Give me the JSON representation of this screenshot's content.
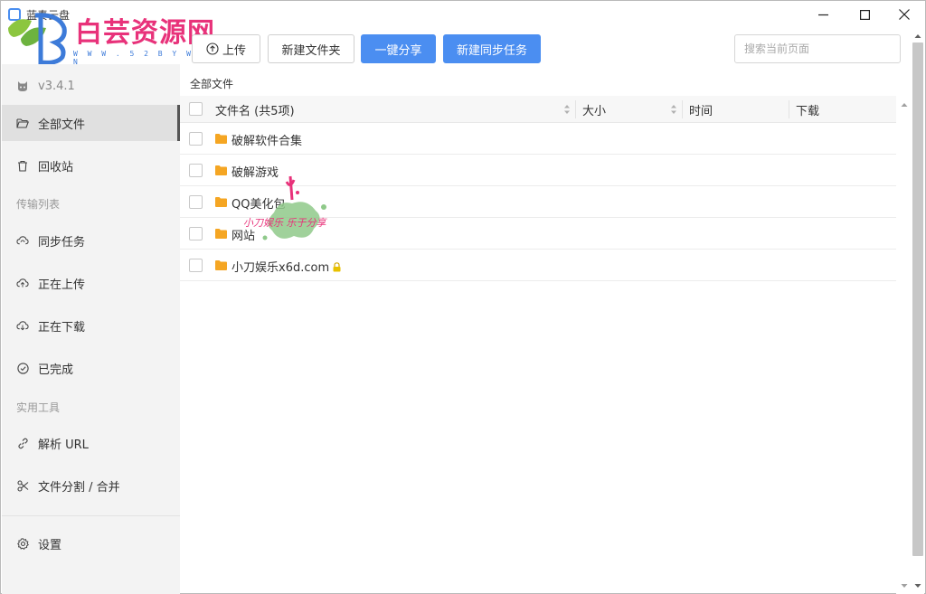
{
  "window": {
    "title": "蓝奏云盘",
    "controls": {
      "minimize": "minimize-icon",
      "maximize": "maximize-icon",
      "close": "close-icon"
    }
  },
  "watermark": {
    "logo_text": "白芸资源网",
    "logo_url": "W W W . 5 2 B Y W . C N",
    "stamp_text": "小刀娱乐 乐于分享"
  },
  "sidebar": {
    "version": "v3.4.1",
    "items": [
      {
        "label": "全部文件",
        "icon": "folder-open-icon",
        "active": true
      },
      {
        "label": "回收站",
        "icon": "trash-icon",
        "active": false
      }
    ],
    "transfer_section": "传输列表",
    "transfer_items": [
      {
        "label": "同步任务",
        "icon": "cloud-sync-icon"
      },
      {
        "label": "正在上传",
        "icon": "cloud-upload-icon"
      },
      {
        "label": "正在下载",
        "icon": "cloud-download-icon"
      },
      {
        "label": "已完成",
        "icon": "check-circle-icon"
      }
    ],
    "tools_section": "实用工具",
    "tool_items": [
      {
        "label": "解析 URL",
        "icon": "link-icon"
      },
      {
        "label": "文件分割 / 合并",
        "icon": "scissors-icon"
      }
    ],
    "settings": {
      "label": "设置",
      "icon": "gear-icon"
    }
  },
  "toolbar": {
    "upload": "上传",
    "new_folder": "新建文件夹",
    "share": "一键分享",
    "new_sync": "新建同步任务",
    "search_placeholder": "搜索当前页面"
  },
  "breadcrumb": "全部文件",
  "table": {
    "columns": {
      "name": "文件名 (共5项)",
      "size": "大小",
      "time": "时间",
      "download": "下载"
    },
    "rows": [
      {
        "name": "破解软件合集",
        "type": "folder",
        "locked": false
      },
      {
        "name": "破解游戏",
        "type": "folder",
        "locked": false
      },
      {
        "name": "QQ美化包",
        "type": "folder",
        "locked": false
      },
      {
        "name": "网站",
        "type": "folder",
        "locked": false
      },
      {
        "name": "小刀娱乐x6d.com",
        "type": "folder",
        "locked": true
      }
    ]
  },
  "colors": {
    "primary": "#4b8ef1",
    "folder": "#f5a623",
    "sidebar_bg": "#f3f3f3",
    "active_bg": "#e0e0e0",
    "lock": "#e0b400"
  }
}
